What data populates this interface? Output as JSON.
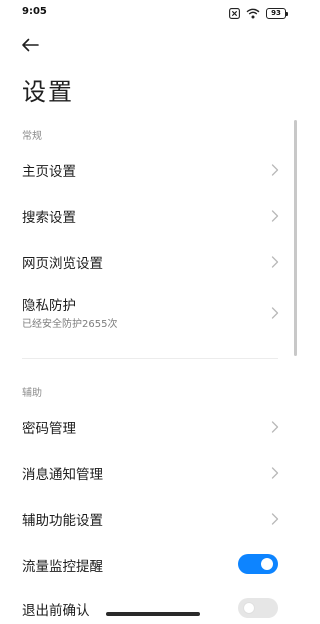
{
  "status_bar": {
    "time": "9:05",
    "battery": "93",
    "icons": [
      "close-box-icon",
      "wifi-icon",
      "battery-icon"
    ]
  },
  "header": {
    "title": "设置",
    "back_icon": "back-arrow-icon"
  },
  "sections": {
    "general": {
      "title": "常规",
      "items": [
        {
          "label": "主页设置"
        },
        {
          "label": "搜索设置"
        },
        {
          "label": "网页浏览设置"
        },
        {
          "label": "隐私防护",
          "subtitle": "已经安全防护2655次"
        }
      ]
    },
    "assist": {
      "title": "辅助",
      "items": [
        {
          "label": "密码管理"
        },
        {
          "label": "消息通知管理"
        },
        {
          "label": "辅助功能设置"
        },
        {
          "label": "流量监控提醒",
          "toggle": true
        },
        {
          "label": "退出前确认",
          "toggle": false
        }
      ]
    }
  },
  "colors": {
    "accent": "#0d84ff",
    "toggle_off": "#e6e6e6",
    "section_title": "#8c8c8c"
  }
}
